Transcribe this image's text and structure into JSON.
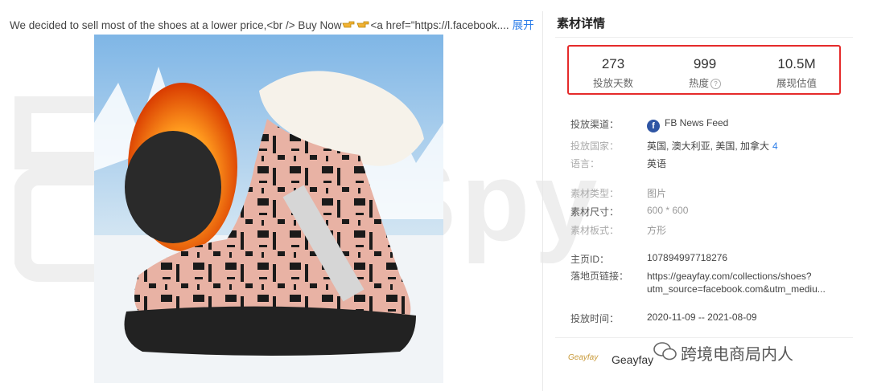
{
  "ad": {
    "caption": "We decided to sell most of the shoes at a lower price,<br /> Buy Now",
    "caption_tail": "<a href=\"https://l.facebook....",
    "expand_label": "展开",
    "watermark": "BigSpy"
  },
  "panel": {
    "title": "素材详情",
    "stats": [
      {
        "value": "273",
        "label": "投放天数"
      },
      {
        "value": "999",
        "label": "热度"
      },
      {
        "value": "10.5M",
        "label": "展现估值"
      }
    ],
    "fields": {
      "channel_label": "投放渠道：",
      "channel_value": "FB News Feed",
      "country_label": "投放国家：",
      "country_value": "英国, 澳大利亚, 美国, 加拿大",
      "country_count": "4",
      "language_label": "语言：",
      "language_value": "英语",
      "type_label": "素材类型：",
      "type_value": "图片",
      "size_label": "素材尺寸：",
      "size_value": "600 * 600",
      "shape_label": "素材板式：",
      "shape_value": "方形",
      "page_id_label": "主页ID：",
      "page_id_value": "107894997718276",
      "landing_label": "落地页链接：",
      "landing_line1": "https://geayfay.com/collections/shoes?",
      "landing_line2": "utm_source=facebook.com&utm_mediu...",
      "period_label": "投放时间：",
      "period_value": "2020-11-09 -- 2021-08-09"
    },
    "brand": {
      "logo_text": "Geayfay",
      "name": "Geayfay"
    }
  },
  "overlay": {
    "wechat_text": "跨境电商局内人"
  },
  "colors": {
    "highlight_border": "#e52b2b",
    "link": "#2b7de9",
    "facebook": "#2f55a4"
  }
}
